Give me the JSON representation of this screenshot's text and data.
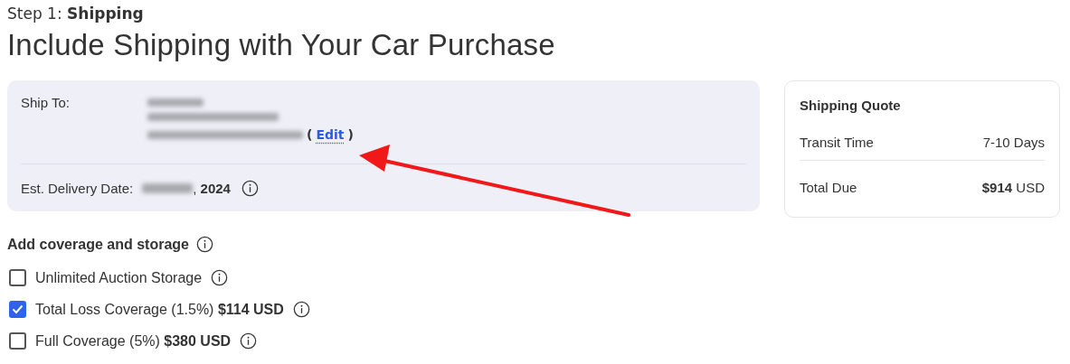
{
  "step": "Step 1: **Shipping**",
  "title": "Include Shipping with Your Car Purchase",
  "ship_card": {
    "ship_to_label": "Ship To:",
    "edit_open": "(",
    "edit_link": "Edit",
    "edit_close": ")",
    "delivery_label": "Est. Delivery Date:",
    "delivery_year": ", **2024**"
  },
  "quote": {
    "title": "Shipping Quote",
    "rows": [
      {
        "label": "Transit Time",
        "value": "7-10 Days"
      },
      {
        "label": "Total Due",
        "value": "**$914** USD"
      }
    ]
  },
  "coverage": {
    "heading": "Add coverage and storage",
    "options": [
      {
        "label": "Unlimited Auction Storage",
        "checked": false
      },
      {
        "label": "Total Loss Coverage (1.5%) **$114 USD**",
        "checked": true
      },
      {
        "label": "Full Coverage (5%) **$380 USD**",
        "checked": false
      }
    ]
  }
}
